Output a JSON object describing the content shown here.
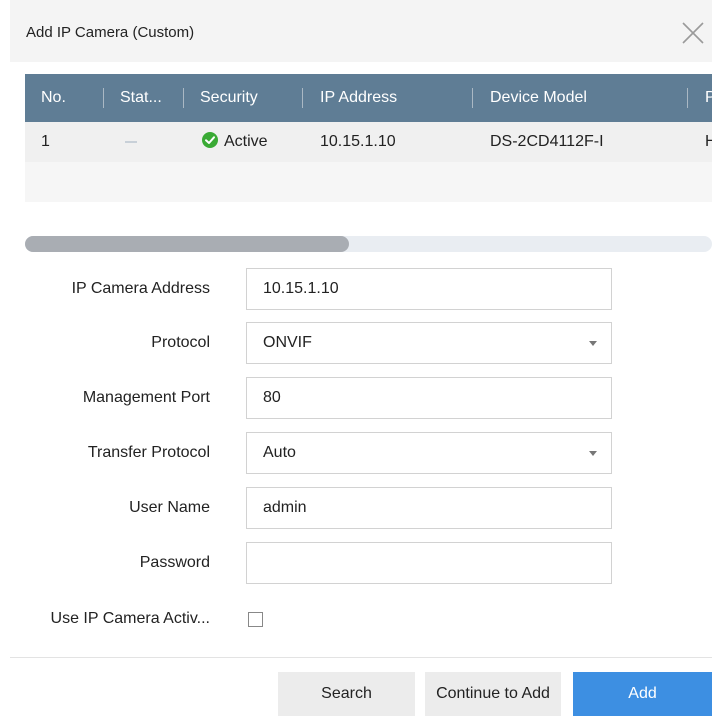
{
  "dialog": {
    "title": "Add IP Camera (Custom)"
  },
  "table": {
    "columns": [
      "No.",
      "Stat...",
      "Security",
      "IP Address",
      "Device Model",
      "P"
    ],
    "rows": [
      {
        "no": "1",
        "status": "",
        "security": "Active",
        "ip": "10.15.1.10",
        "model": "DS-2CD4112F-I",
        "extra": "H"
      }
    ]
  },
  "form": {
    "ip_camera_address": {
      "label": "IP Camera Address",
      "value": "10.15.1.10"
    },
    "protocol": {
      "label": "Protocol",
      "value": "ONVIF"
    },
    "management_port": {
      "label": "Management Port",
      "value": "80"
    },
    "transfer_protocol": {
      "label": "Transfer Protocol",
      "value": "Auto"
    },
    "user_name": {
      "label": "User Name",
      "value": "admin"
    },
    "password": {
      "label": "Password",
      "value": ""
    },
    "use_activation": {
      "label": "Use IP Camera Activ...",
      "checked": false
    }
  },
  "buttons": {
    "search": "Search",
    "continue_to_add": "Continue to Add",
    "add": "Add"
  },
  "colors": {
    "header_bg": "#5f7d95",
    "primary": "#3d8fe2",
    "active_green": "#3aaa35"
  }
}
